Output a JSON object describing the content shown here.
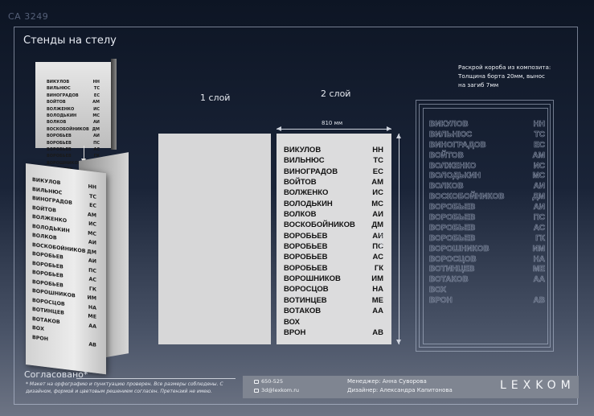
{
  "project_code": "СА 3249",
  "sheet_title": "Стенды на стелу",
  "layers": {
    "layer1": "1 слой",
    "layer2": "2 слой"
  },
  "dimensions": {
    "width": "810 мм",
    "height": "1500мм"
  },
  "composite_note": "Раскрой короба из композита:\nТолщина борта 20мм, вынос\nна загиб 7мм",
  "rows": [
    {
      "name": "ВИКУЛОВ",
      "code": "НН"
    },
    {
      "name": "ВИЛЬНЮС",
      "code": "ТС"
    },
    {
      "name": "ВИНОГРАДОВ",
      "code": "ЕС"
    },
    {
      "name": "ВОЙТОВ",
      "code": "АМ"
    },
    {
      "name": "ВОЛЖЕНКО",
      "code": "ИС"
    },
    {
      "name": "ВОЛОДЬКИН",
      "code": "МС"
    },
    {
      "name": "ВОЛКОВ",
      "code": "АИ"
    },
    {
      "name": "ВОСКОБОЙНИКОВ",
      "code": "ДМ"
    },
    {
      "name": "ВОРОБЬЕВ",
      "code": "АИ"
    },
    {
      "name": "ВОРОБЬЕВ",
      "code": "ПС"
    },
    {
      "name": "ВОРОБЬЕВ",
      "code": "АС"
    },
    {
      "name": "ВОРОБЬЕВ",
      "code": "ГК"
    },
    {
      "name": "ВОРОШНИКОВ",
      "code": "ИМ"
    },
    {
      "name": "ВОРОСЦОВ",
      "code": "НА"
    },
    {
      "name": "ВОТИНЦЕВ",
      "code": "МЕ"
    },
    {
      "name": "ВОТАКОВ",
      "code": "АА"
    },
    {
      "name": "ВОХ",
      "code": ""
    },
    {
      "name": "ВРОН",
      "code": "АВ"
    }
  ],
  "footer": {
    "approved": "Согласовано*",
    "disclaimer": "* Макет на орфографию и пунктуацию проверен. Все размеры соблюдены. С дизайном, формой и цветовым решением согласен. Претензий не имею.",
    "phone": "650-525",
    "email": "3d@lexkom.ru",
    "manager": "Менеджер: Анна Суворова",
    "designer": "Дизайнер: Александра Капитонова",
    "brand": "LEXKOM"
  },
  "colors": {
    "background_top": "#0d1524",
    "background_bottom": "#6d7484",
    "panel": "#dcdcdd",
    "footer_bar": "#7f8591"
  }
}
